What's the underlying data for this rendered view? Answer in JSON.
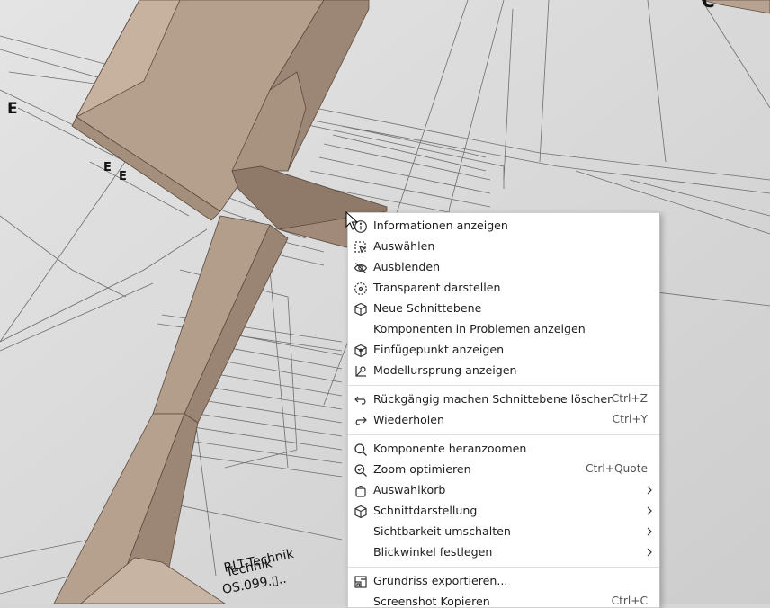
{
  "viewport": {
    "labels": {
      "e1": "E",
      "e2": "E",
      "e3": "E",
      "c": "C",
      "room_name": "Technik",
      "room_name_overlay": "RLT-Technik",
      "room_id": "OS.099.▯.."
    }
  },
  "context_menu": {
    "items": [
      {
        "label": "Informationen anzeigen",
        "icon": "info-icon"
      },
      {
        "label": "Auswählen",
        "icon": "select-icon"
      },
      {
        "label": "Ausblenden",
        "icon": "eye-slash-icon"
      },
      {
        "label": "Transparent darstellen",
        "icon": "transparent-icon"
      },
      {
        "label": "Neue Schnittebene",
        "icon": "section-cube-icon"
      },
      {
        "label": "Komponenten in Problemen anzeigen",
        "icon": ""
      },
      {
        "label": "Einfügepunkt anzeigen",
        "icon": "insertion-point-icon"
      },
      {
        "label": "Modellursprung anzeigen",
        "icon": "model-origin-icon"
      },
      {
        "label": "Rückgängig machen Schnittebene löschen",
        "icon": "undo-icon",
        "shortcut": "Ctrl+Z"
      },
      {
        "label": "Wiederholen",
        "icon": "redo-icon",
        "shortcut": "Ctrl+Y"
      },
      {
        "label": "Komponente heranzoomen",
        "icon": "zoom-icon"
      },
      {
        "label": "Zoom optimieren",
        "icon": "zoom-fit-icon",
        "shortcut": "Ctrl+Quote"
      },
      {
        "label": "Auswahlkorb",
        "icon": "basket-icon",
        "submenu": true
      },
      {
        "label": "Schnittdarstellung",
        "icon": "section-view-icon",
        "submenu": true
      },
      {
        "label": "Sichtbarkeit umschalten",
        "icon": "",
        "submenu": true
      },
      {
        "label": "Blickwinkel festlegen",
        "icon": "",
        "submenu": true
      },
      {
        "label": "Grundriss exportieren...",
        "icon": "floorplan-export-icon"
      },
      {
        "label": "Screenshot Kopieren",
        "icon": "",
        "shortcut": "Ctrl+C"
      }
    ]
  }
}
